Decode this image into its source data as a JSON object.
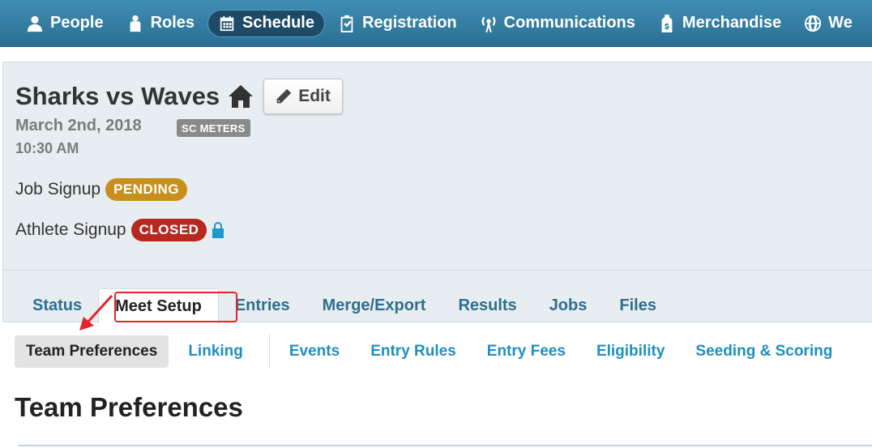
{
  "nav": {
    "items": [
      {
        "label": "People",
        "icon": "person-icon"
      },
      {
        "label": "Roles",
        "icon": "roles-icon"
      },
      {
        "label": "Schedule",
        "icon": "calendar-icon",
        "active": true
      },
      {
        "label": "Registration",
        "icon": "clipboard-check-icon"
      },
      {
        "label": "Communications",
        "icon": "antenna-icon"
      },
      {
        "label": "Merchandise",
        "icon": "price-tag-icon"
      },
      {
        "label": "We",
        "icon": "globe-icon"
      }
    ]
  },
  "meet": {
    "title": "Sharks vs Waves",
    "edit_label": "Edit",
    "date": "March 2nd, 2018",
    "course_badge": "SC METERS",
    "time": "10:30 AM",
    "job_signup_label": "Job Signup",
    "job_signup_status": "PENDING",
    "athlete_signup_label": "Athlete Signup",
    "athlete_signup_status": "CLOSED"
  },
  "tabs": [
    {
      "label": "Status"
    },
    {
      "label": "Meet Setup",
      "active": true
    },
    {
      "label": "Entries"
    },
    {
      "label": "Merge/Export"
    },
    {
      "label": "Results"
    },
    {
      "label": "Jobs"
    },
    {
      "label": "Files"
    }
  ],
  "subnav": [
    {
      "label": "Team Preferences",
      "active": true
    },
    {
      "label": "Linking"
    },
    {
      "label": "Events"
    },
    {
      "label": "Entry Rules"
    },
    {
      "label": "Entry Fees"
    },
    {
      "label": "Eligibility"
    },
    {
      "label": "Seeding & Scoring"
    }
  ],
  "section_title": "Team Preferences",
  "colors": {
    "nav_bg": "#2b6f93",
    "panel_bg": "#e7edf0",
    "link": "#1f8fbf",
    "pending": "#c8901a",
    "closed": "#b7281e",
    "annotation": "#e3242b"
  }
}
